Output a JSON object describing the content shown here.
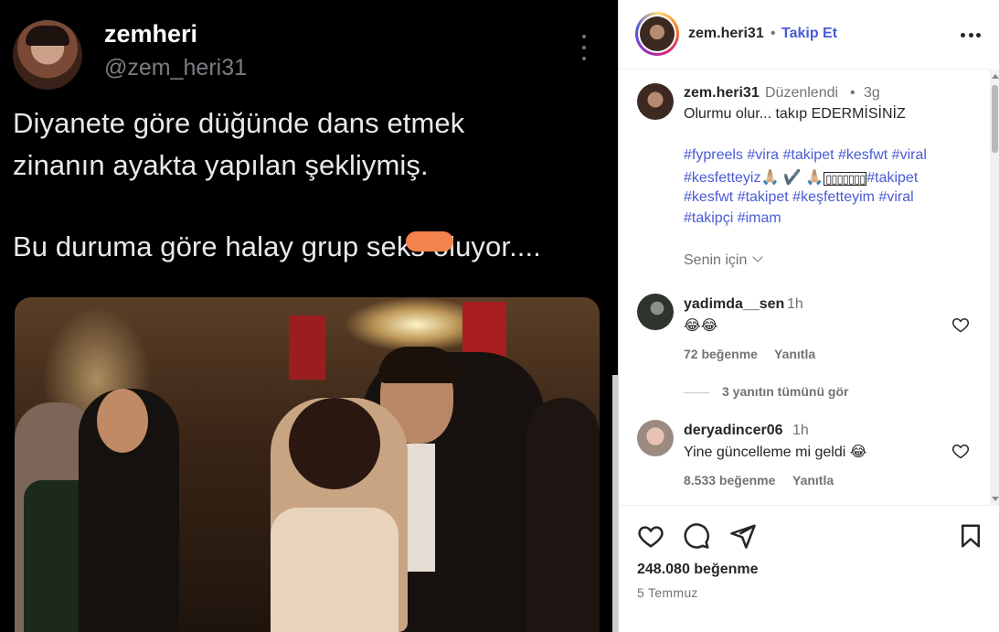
{
  "tweet": {
    "name": "zemheri",
    "handle": "@zem_heri31",
    "line1": "Diyanete göre düğünde dans etmek",
    "line2": "zinanın ayakta yapılan şekliymiş.",
    "line3": "Bu duruma göre halay grup seks oluyor...."
  },
  "header": {
    "username": "zem.heri31",
    "separator": "•",
    "follow_label": "Takip Et"
  },
  "caption": {
    "username": "zem.heri31",
    "edited_label": "Düzenlendi",
    "separator": "•",
    "time": "3g",
    "text": "Olurmu olur... takıp EDERMİSİNİZ",
    "tags_line1": "#fypreels #vira #takipet #kesfwt #viral",
    "tags_line2_a": "#kesfetteyiz🙏🏼 ✔️ 🙏🏼",
    "tags_line2_boxes": "▯▯▯▯▯▯▯",
    "tags_line2_b": "#takipet",
    "tags_line3": "#kesfwt #takipet #keşfetteyim #viral",
    "tags_line4": "#takipçi #imam",
    "for_you_label": "Senin için"
  },
  "comments": [
    {
      "username": "yadimda__sen",
      "time": "1h",
      "text": "😂😂",
      "likes": "72 beğenme",
      "reply_label": "Yanıtla"
    },
    {
      "username": "deryadincer06",
      "time": "1h",
      "text": "Yine güncelleme mi geldi 😂",
      "likes": "8.533 beğenme",
      "reply_label": "Yanıtla"
    }
  ],
  "view_replies_label": "3 yanıtın tümünü gör",
  "footer": {
    "likes": "248.080 beğenme",
    "date": "5 Temmuz"
  },
  "colors": {
    "link_blue": "#4a5bd4",
    "muted": "#737373",
    "text": "#262626",
    "censor": "#f4824c"
  }
}
